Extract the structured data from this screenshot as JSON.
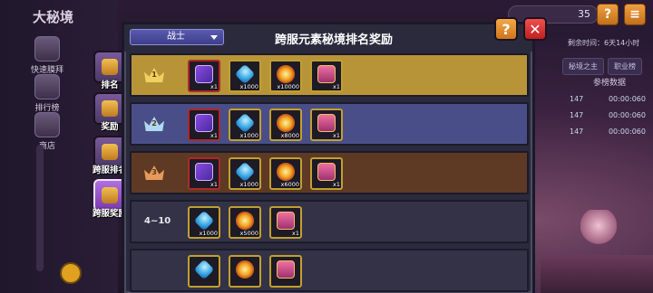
{
  "background": {
    "title": "大秘境",
    "menu": [
      {
        "label": "快速膜拜"
      },
      {
        "label": "排行榜"
      },
      {
        "label": "商店"
      }
    ],
    "resource_count": "35",
    "time_label": "剩余时间：6天14小时",
    "tabs": [
      "秘境之主",
      "职业榜"
    ],
    "ref_data_label": "参榜数据",
    "ref_rows": [
      {
        "value": "147",
        "time": "00:00:060"
      },
      {
        "value": "147",
        "time": "00:00:060"
      },
      {
        "value": "147",
        "time": "00:00:060"
      }
    ]
  },
  "side_tabs": [
    {
      "label": "排名",
      "active": false
    },
    {
      "label": "奖励",
      "active": false
    },
    {
      "label": "跨服排名",
      "active": false
    },
    {
      "label": "跨服奖励",
      "active": true
    }
  ],
  "modal": {
    "title": "跨服元素秘境排名奖励",
    "class_select": "战士",
    "help_label": "?",
    "close_label": "✕"
  },
  "ranks": [
    {
      "rank": "1",
      "color": "#b89438",
      "crown": "#f0d060",
      "items": [
        {
          "icon": "card-icon",
          "qty": "x1"
        },
        {
          "icon": "gem-icon",
          "qty": "x1000"
        },
        {
          "icon": "burst-icon",
          "qty": "x10000"
        },
        {
          "icon": "chest-icon",
          "qty": "x1"
        }
      ]
    },
    {
      "rank": "2",
      "color": "#4a4e88",
      "crown": "#b0d8f0",
      "items": [
        {
          "icon": "card-icon",
          "qty": "x1"
        },
        {
          "icon": "gem-icon",
          "qty": "x1000"
        },
        {
          "icon": "burst-icon",
          "qty": "x8000"
        },
        {
          "icon": "chest-icon",
          "qty": "x1"
        }
      ]
    },
    {
      "rank": "3",
      "color": "#5e3a24",
      "crown": "#e89a5a",
      "items": [
        {
          "icon": "card-icon",
          "qty": "x1"
        },
        {
          "icon": "gem-icon",
          "qty": "x1000"
        },
        {
          "icon": "burst-icon",
          "qty": "x6000"
        },
        {
          "icon": "chest-icon",
          "qty": "x1"
        }
      ]
    },
    {
      "range": "4~10",
      "color": "#343247",
      "items": [
        {
          "icon": "gem-icon",
          "qty": "x1000"
        },
        {
          "icon": "burst-icon",
          "qty": "x5000"
        },
        {
          "icon": "chest-icon",
          "qty": "x1"
        }
      ]
    },
    {
      "range": "",
      "color": "#343247",
      "items": [
        {
          "icon": "gem-icon",
          "qty": ""
        },
        {
          "icon": "burst-icon",
          "qty": ""
        },
        {
          "icon": "chest-icon",
          "qty": ""
        }
      ]
    }
  ]
}
